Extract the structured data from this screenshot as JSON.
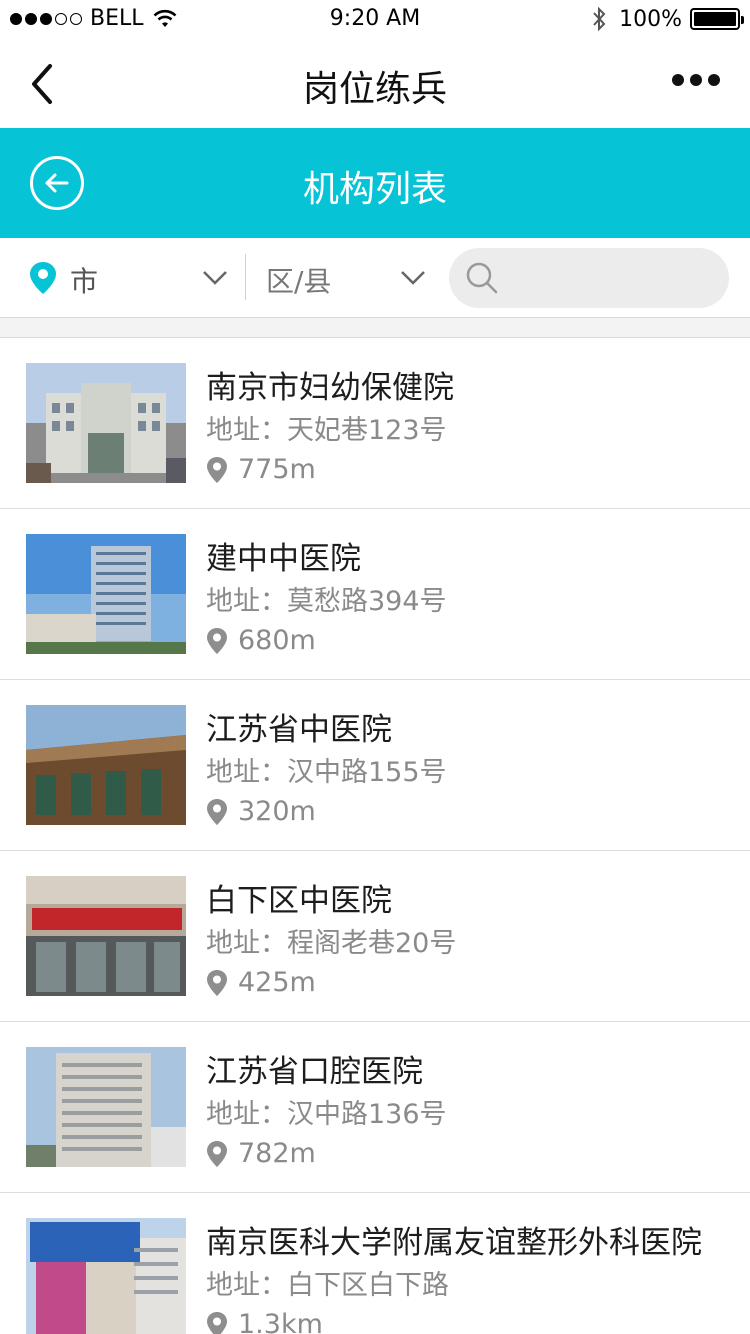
{
  "status_bar": {
    "carrier": "BELL",
    "time": "9:20 AM",
    "battery": "100%"
  },
  "nav": {
    "title": "岗位练兵"
  },
  "header": {
    "title": "机构列表",
    "accent_color": "#07c3d6"
  },
  "filters": {
    "city_label": "市",
    "district_label": "区/县",
    "search_value": ""
  },
  "list": [
    {
      "name": "南京市妇幼保健院",
      "address": "地址：天妃巷123号",
      "distance": "775m"
    },
    {
      "name": "建中中医院",
      "address": "地址：莫愁路394号",
      "distance": "680m"
    },
    {
      "name": "江苏省中医院",
      "address": "地址：汉中路155号",
      "distance": "320m"
    },
    {
      "name": "白下区中医院",
      "address": "地址：程阁老巷20号",
      "distance": "425m"
    },
    {
      "name": "江苏省口腔医院",
      "address": "地址：汉中路136号",
      "distance": "782m"
    },
    {
      "name": "南京医科大学附属友谊整形外科医院",
      "address": "地址：白下区白下路",
      "distance": "1.3km"
    }
  ]
}
